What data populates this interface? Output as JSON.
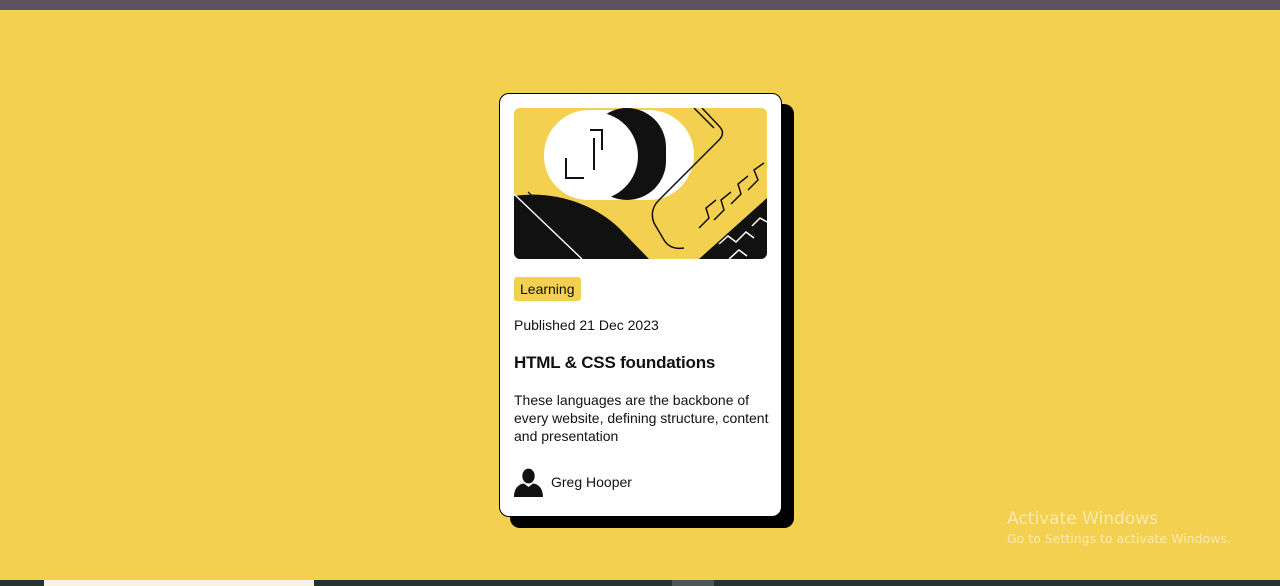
{
  "card": {
    "tag": "Learning",
    "published": "Published 21 Dec 2023",
    "title": "HTML & CSS foundations",
    "description": "These languages are the backbone of every website, defining structure, content and presentation",
    "author": "Greg Hooper",
    "illustration_icon": "abstract-illustration",
    "avatar_icon": "person-silhouette-icon"
  },
  "watermark": {
    "title": "Activate Windows",
    "subtitle": "Go to Settings to activate Windows."
  },
  "colors": {
    "background": "#f3d04f",
    "card": "#ffffff",
    "shadow": "#000000",
    "tag_background": "#f3d04f",
    "top_bar": "#5e5160"
  }
}
